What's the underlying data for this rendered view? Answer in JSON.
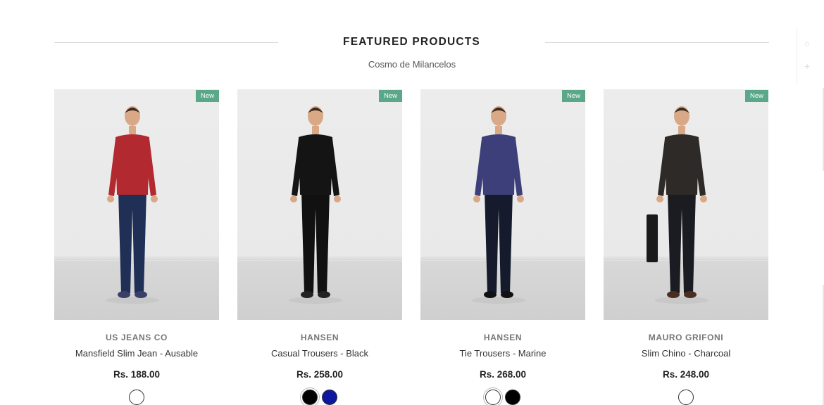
{
  "section": {
    "title": "FEATURED PRODUCTS",
    "subtitle": "Cosmo de Milancelos"
  },
  "products": [
    {
      "badge": "New",
      "brand": "US JEANS CO",
      "name": "Mansfield Slim Jean - Ausable",
      "price": "Rs. 188.00",
      "swatches": [
        "#ffffff"
      ],
      "colors": {
        "top": "#b22a30",
        "bottom": "#1f2f55",
        "shoe": "#3a3f6a"
      }
    },
    {
      "badge": "New",
      "brand": "HANSEN",
      "name": "Casual Trousers - Black",
      "price": "Rs. 258.00",
      "swatches": [
        "#000000",
        "#0d17a0"
      ],
      "colors": {
        "top": "#141414",
        "bottom": "#111111",
        "shoe": "#222222"
      }
    },
    {
      "badge": "New",
      "brand": "HANSEN",
      "name": "Tie Trousers - Marine",
      "price": "Rs. 268.00",
      "swatches": [
        "#ffffff",
        "#000000"
      ],
      "colors": {
        "top": "#3d3f7a",
        "bottom": "#151b2c",
        "shoe": "#111111"
      }
    },
    {
      "badge": "New",
      "brand": "MAURO GRIFONI",
      "name": "Slim Chino - Charcoal",
      "price": "Rs. 248.00",
      "swatches": [
        "#ffffff"
      ],
      "colors": {
        "top": "#2e2a27",
        "bottom": "#1a1c22",
        "shoe": "#4a2e22"
      }
    }
  ],
  "theme": {
    "badge_color": "#5aa78a",
    "skin": "#d9a886",
    "hair": "#3a2a20"
  }
}
